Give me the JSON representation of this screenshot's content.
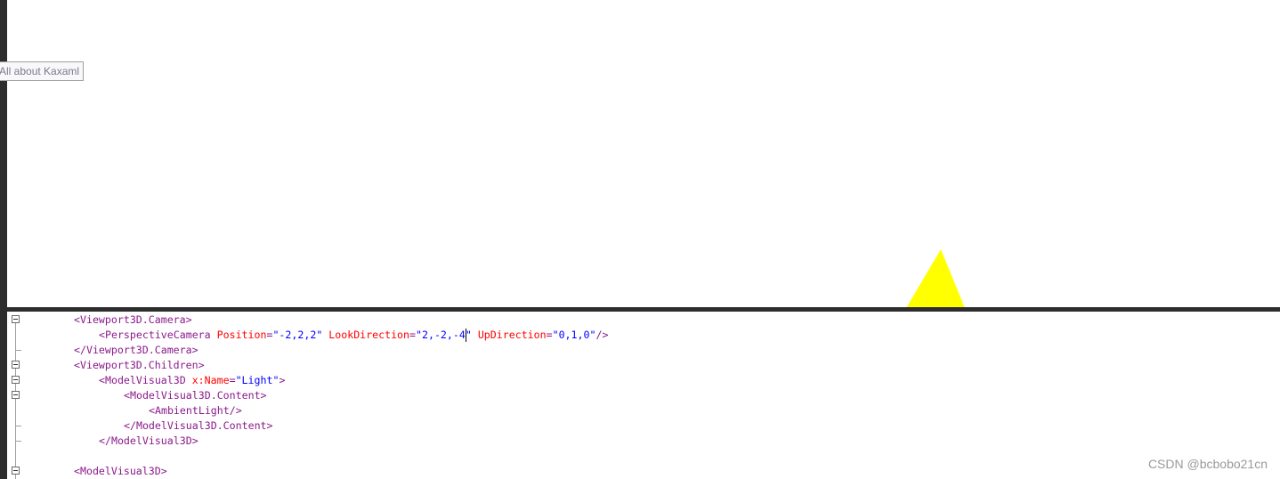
{
  "preview": {
    "tooltip": "All about Kaxaml",
    "shape_color": "#ffff00"
  },
  "editor": {
    "lines": [
      {
        "indent": 0,
        "fold": "box",
        "tokens": [
          [
            "t-tag",
            "<Viewport3D.Camera>"
          ]
        ]
      },
      {
        "indent": 1,
        "fold": "none",
        "tokens": [
          [
            "t-tag",
            "<PerspectiveCamera "
          ],
          [
            "t-attr",
            "Position"
          ],
          [
            "t-punct",
            "="
          ],
          [
            "t-val",
            "\"-2,2,2\" "
          ],
          [
            "t-attr",
            "LookDirection"
          ],
          [
            "t-punct",
            "="
          ],
          [
            "t-val",
            "\"2,-2,-4"
          ],
          [
            "caret",
            ""
          ],
          [
            "t-val",
            "\" "
          ],
          [
            "t-attr",
            "UpDirection"
          ],
          [
            "t-punct",
            "="
          ],
          [
            "t-val",
            "\"0,1,0\""
          ],
          [
            "t-tag",
            "/>"
          ]
        ]
      },
      {
        "indent": 0,
        "fold": "end",
        "tokens": [
          [
            "t-tag",
            "</Viewport3D.Camera>"
          ]
        ]
      },
      {
        "indent": 0,
        "fold": "box",
        "tokens": [
          [
            "t-tag",
            "<Viewport3D.Children>"
          ]
        ]
      },
      {
        "indent": 1,
        "fold": "box",
        "tokens": [
          [
            "t-tag",
            "<ModelVisual3D "
          ],
          [
            "t-attr",
            "x:Name"
          ],
          [
            "t-punct",
            "="
          ],
          [
            "t-val",
            "\"Light\""
          ],
          [
            "t-tag",
            ">"
          ]
        ]
      },
      {
        "indent": 2,
        "fold": "box",
        "tokens": [
          [
            "t-tag",
            "<ModelVisual3D.Content>"
          ]
        ]
      },
      {
        "indent": 3,
        "fold": "none",
        "tokens": [
          [
            "t-tag",
            "<AmbientLight/>"
          ]
        ]
      },
      {
        "indent": 2,
        "fold": "end",
        "tokens": [
          [
            "t-tag",
            "</ModelVisual3D.Content>"
          ]
        ]
      },
      {
        "indent": 1,
        "fold": "end",
        "tokens": [
          [
            "t-tag",
            "</ModelVisual3D>"
          ]
        ]
      },
      {
        "indent": 0,
        "fold": "none",
        "tokens": []
      },
      {
        "indent": 0,
        "fold": "box",
        "tokens": [
          [
            "t-tag",
            "<ModelVisual3D>"
          ]
        ]
      }
    ]
  },
  "watermark": "CSDN @bcbobo21cn"
}
